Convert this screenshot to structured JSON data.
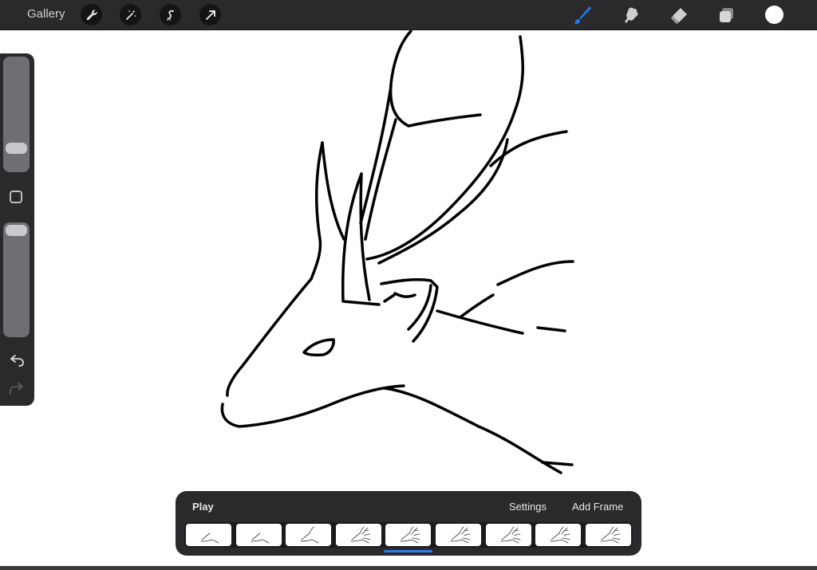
{
  "topbar": {
    "gallery_label": "Gallery",
    "left_tools": [
      "wrench-icon",
      "magic-wand-icon",
      "selection-icon",
      "transform-arrow-icon"
    ],
    "right_tools": [
      "brush-icon",
      "smudge-icon",
      "eraser-icon",
      "layers-icon"
    ],
    "brush_color": "#1e7cf0",
    "current_color": "#ffffff"
  },
  "sidebar": {
    "brush_size": 0.24,
    "opacity": 0.04
  },
  "timeline": {
    "play_label": "Play",
    "settings_label": "Settings",
    "add_frame_label": "Add Frame",
    "frame_count": 9,
    "selected_frame": 5,
    "indicator_color": "#2d7bf0"
  }
}
